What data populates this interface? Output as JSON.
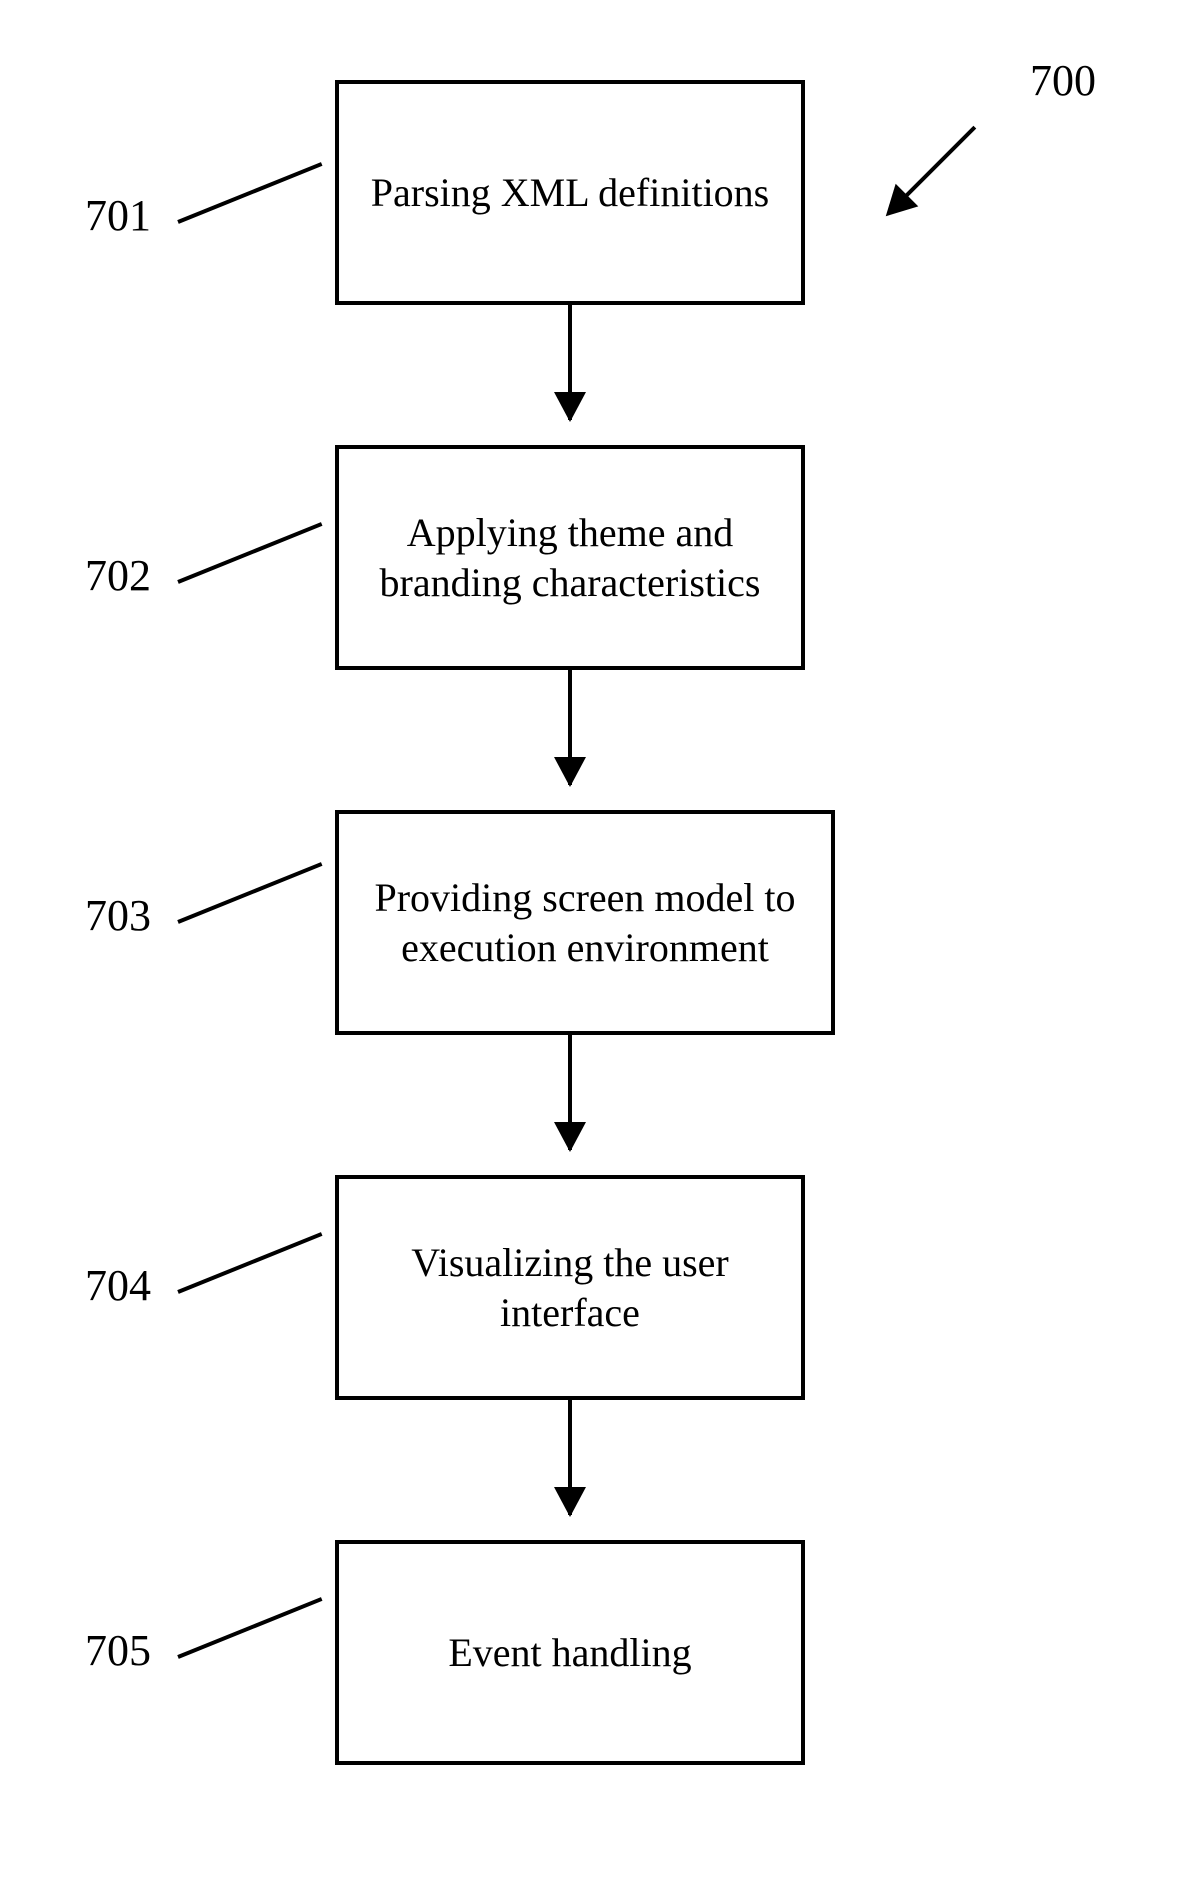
{
  "diagram": {
    "title_ref": "700",
    "steps": [
      {
        "ref": "701",
        "text": "Parsing XML definitions"
      },
      {
        "ref": "702",
        "text": "Applying theme and branding characteristics"
      },
      {
        "ref": "703",
        "text": "Providing screen model to execution environment"
      },
      {
        "ref": "704",
        "text": "Visualizing the user interface"
      },
      {
        "ref": "705",
        "text": "Event handling"
      }
    ]
  }
}
